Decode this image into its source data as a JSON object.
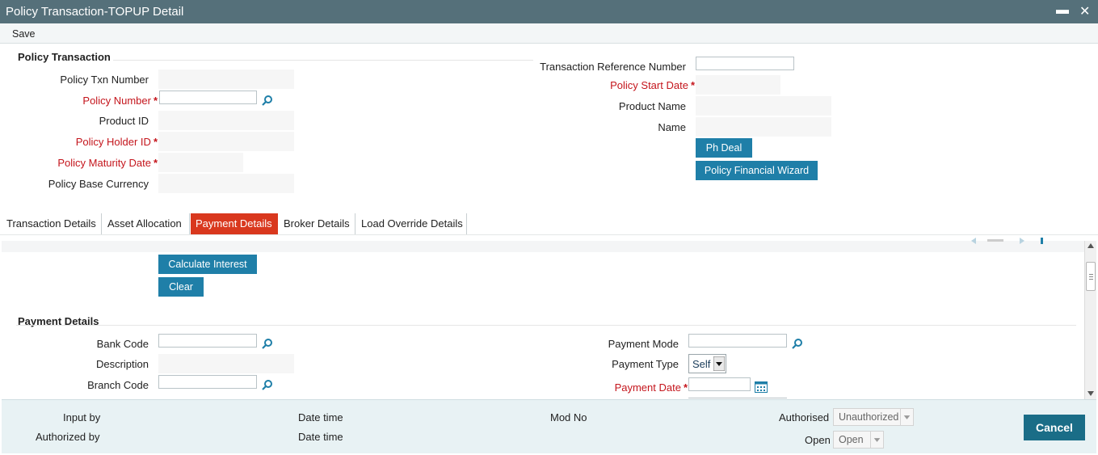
{
  "window": {
    "title": "Policy Transaction-TOPUP Detail",
    "minimize": "▬",
    "close": "✕"
  },
  "menu": {
    "save_label": "Save"
  },
  "policy_transaction": {
    "title": "Policy Transaction",
    "policy_txn_number_label": "Policy Txn Number",
    "policy_number_label": "Policy Number",
    "product_id_label": "Product ID",
    "policy_holder_id_label": "Policy Holder ID",
    "policy_maturity_date_label": "Policy Maturity Date",
    "policy_base_currency_label": "Policy Base Currency",
    "transaction_reference_number_label": "Transaction Reference Number",
    "policy_start_date_label": "Policy Start Date",
    "product_name_label": "Product Name",
    "name_label": "Name",
    "required_marker": "*",
    "ph_deal_button": "Ph Deal",
    "policy_financial_wizard_button": "Policy Financial Wizard"
  },
  "tabs": [
    {
      "label": "Transaction Details",
      "active": false
    },
    {
      "label": "Asset Allocation",
      "active": false
    },
    {
      "label": "Payment Details",
      "active": true
    },
    {
      "label": "Broker Details",
      "active": false
    },
    {
      "label": "Load Override Details",
      "active": false
    }
  ],
  "payment_tab": {
    "calculate_interest_button": "Calculate Interest",
    "clear_button": "Clear",
    "section_title": "Payment Details",
    "bank_code_label": "Bank Code",
    "description_label": "Description",
    "branch_code_label": "Branch Code",
    "payment_mode_label": "Payment Mode",
    "payment_type_label": "Payment Type",
    "payment_type_value": "Self",
    "payment_date_label": "Payment Date"
  },
  "footer": {
    "input_by_label": "Input by",
    "authorized_by_label": "Authorized by",
    "date_time_label_1": "Date time",
    "date_time_label_2": "Date time",
    "mod_no_label": "Mod No",
    "authorised_label": "Authorised",
    "authorised_value": "Unauthorized",
    "open_label": "Open",
    "open_value": "Open",
    "cancel_button": "Cancel"
  },
  "colors": {
    "titlebar": "#55707a",
    "button_blue": "#1f7fa8",
    "active_tab": "#d9381e",
    "required_red": "#c4151c",
    "cancel_button": "#1a6d87"
  },
  "icons": {
    "lookup": "search-icon",
    "calendar": "calendar-icon",
    "dropdown": "chevron-down-icon"
  }
}
